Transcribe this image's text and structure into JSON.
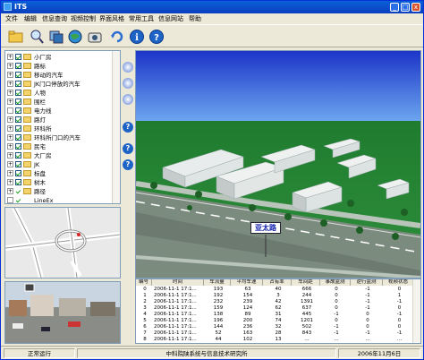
{
  "window": {
    "title": "ITS"
  },
  "menu": [
    "文件",
    "编辑",
    "信息查询",
    "视频控制",
    "界面风格",
    "常用工具",
    "信息网站",
    "帮助"
  ],
  "toolbar": [
    {
      "icon": "folder-open-icon"
    },
    {
      "icon": "zoom-icon"
    },
    {
      "icon": "layer-icon"
    },
    {
      "icon": "globe-icon"
    },
    {
      "icon": "camera-icon"
    },
    {
      "icon": "refresh-icon"
    },
    {
      "icon": "info-icon"
    },
    {
      "icon": "help-icon"
    }
  ],
  "tree": {
    "items": [
      {
        "label": "小厂房",
        "expand": "+",
        "checked": true,
        "folder": true
      },
      {
        "label": "路标",
        "expand": "+",
        "checked": true,
        "folder": true
      },
      {
        "label": "移动的汽车",
        "expand": "+",
        "checked": true,
        "folder": true
      },
      {
        "label": "JK门口停放的汽车",
        "expand": "+",
        "checked": true,
        "folder": true
      },
      {
        "label": "人物",
        "expand": "+",
        "checked": true,
        "folder": true
      },
      {
        "label": "围栏",
        "expand": "+",
        "checked": true,
        "folder": true
      },
      {
        "label": "电力线",
        "expand": "",
        "checked": true,
        "folder": true
      },
      {
        "label": "路灯",
        "expand": "+",
        "checked": true,
        "folder": true
      },
      {
        "label": "环科所",
        "expand": "+",
        "checked": true,
        "folder": true
      },
      {
        "label": "环科所门口的汽车",
        "expand": "+",
        "checked": true,
        "folder": true
      },
      {
        "label": "民宅",
        "expand": "+",
        "checked": true,
        "folder": true
      },
      {
        "label": "大厂房",
        "expand": "+",
        "checked": true,
        "folder": true
      },
      {
        "label": "JK",
        "expand": "+",
        "checked": true,
        "folder": true
      },
      {
        "label": "标盘",
        "expand": "+",
        "checked": true,
        "folder": true
      },
      {
        "label": "树木",
        "expand": "+",
        "checked": true,
        "folder": true
      },
      {
        "label": "路径",
        "expand": "+",
        "checked": false,
        "folder": true
      },
      {
        "label": "LineEx",
        "expand": "",
        "checked": false,
        "folder": false
      }
    ]
  },
  "scene": {
    "road_sign": "亚太路"
  },
  "side_buttons": [
    "globe-nav-icon",
    "zoom-nav-icon",
    "rotate-nav-icon",
    "help-icon",
    "help-icon",
    "help-icon"
  ],
  "table": {
    "headers": [
      "编号",
      "时间",
      "车流量",
      "平均车速",
      "占有率",
      "车间距",
      "事故监测",
      "逆行监测",
      "视频状态"
    ],
    "rows": [
      [
        "0",
        "2006-11-1 17:1...",
        "193",
        "63",
        "40",
        "666",
        "0",
        "-1",
        "0"
      ],
      [
        "1",
        "2006-11-1 17:1...",
        "192",
        "154",
        "3",
        "244",
        "0",
        "-1",
        "1"
      ],
      [
        "2",
        "2006-11-1 17:1...",
        "232",
        "239",
        "42",
        "1391",
        "0",
        "-1",
        "-1"
      ],
      [
        "3",
        "2006-11-1 17:1...",
        "159",
        "124",
        "62",
        "637",
        "0",
        "-1",
        "0"
      ],
      [
        "4",
        "2006-11-1 17:1...",
        "138",
        "89",
        "31",
        "445",
        "-1",
        "0",
        "-1"
      ],
      [
        "5",
        "2006-11-1 17:1...",
        "196",
        "200",
        "74",
        "1201",
        "0",
        "0",
        "0"
      ],
      [
        "6",
        "2006-11-1 17:1...",
        "144",
        "236",
        "32",
        "502",
        "-1",
        "0",
        "0"
      ],
      [
        "7",
        "2006-11-1 17:1...",
        "52",
        "163",
        "28",
        "843",
        "-1",
        "-1",
        "-1"
      ],
      [
        "8",
        "2006-11-1 17:1...",
        "44",
        "102",
        "13",
        "...",
        "...",
        "...",
        "..."
      ]
    ]
  },
  "status": {
    "left": "正常运行",
    "center": "中科院陕系统与信息技术研究所",
    "right": "2006年11月6日"
  }
}
